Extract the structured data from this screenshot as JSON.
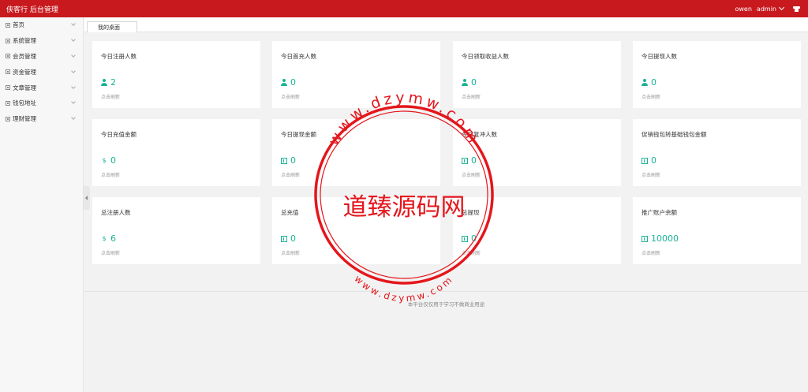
{
  "header": {
    "title": "侠客行 后台管理",
    "user": "owen",
    "role": "admin",
    "bar_color": "#c8191e"
  },
  "sidebar": {
    "items": [
      {
        "label": "首页"
      },
      {
        "label": "系统管理"
      },
      {
        "label": "会员管理"
      },
      {
        "label": "资金管理"
      },
      {
        "label": "文章管理"
      },
      {
        "label": "钱包地址"
      },
      {
        "label": "理财管理"
      }
    ]
  },
  "tabs": [
    {
      "label": "我的桌面"
    }
  ],
  "cards": [
    {
      "title": "今日注册人数",
      "value": "2",
      "icon": "person-icon",
      "note": "点击刷新"
    },
    {
      "title": "今日首充人数",
      "value": "0",
      "icon": "person-icon",
      "note": "点击刷新"
    },
    {
      "title": "今日领取收益人数",
      "value": "0",
      "icon": "person-icon",
      "note": "点击刷新"
    },
    {
      "title": "今日提现人数",
      "value": "0",
      "icon": "person-icon",
      "note": "点击刷新"
    },
    {
      "title": "今日充值金额",
      "value": "0",
      "icon": "money-icon",
      "note": "点击刷新"
    },
    {
      "title": "今日提现金额",
      "value": "0",
      "icon": "bill-icon",
      "note": "点击刷新"
    },
    {
      "title": "今日复冲人数",
      "value": "0",
      "icon": "bill-icon",
      "note": "点击刷新"
    },
    {
      "title": "促销钱包转基础钱包金额",
      "value": "0",
      "icon": "bill-icon",
      "note": "点击刷新"
    },
    {
      "title": "总注册人数",
      "value": "6",
      "icon": "money-icon",
      "note": "点击刷新"
    },
    {
      "title": "总充值",
      "value": "0",
      "icon": "bill-icon",
      "note": "点击刷新"
    },
    {
      "title": "总提现",
      "value": "0",
      "icon": "bill-icon",
      "note": "点击刷新"
    },
    {
      "title": "推广账户余额",
      "value": "10000",
      "icon": "bill-icon",
      "note": "点击刷新"
    }
  ],
  "footer": {
    "text": "本平台仅仅用于学习不做商业用途"
  },
  "watermark": {
    "center_text": "道臻源码网",
    "ring_top": "www.dzymw.com",
    "ring_bottom": "www.dzymw.com",
    "color": "#e4161c"
  },
  "accent_color": "#1ab394"
}
